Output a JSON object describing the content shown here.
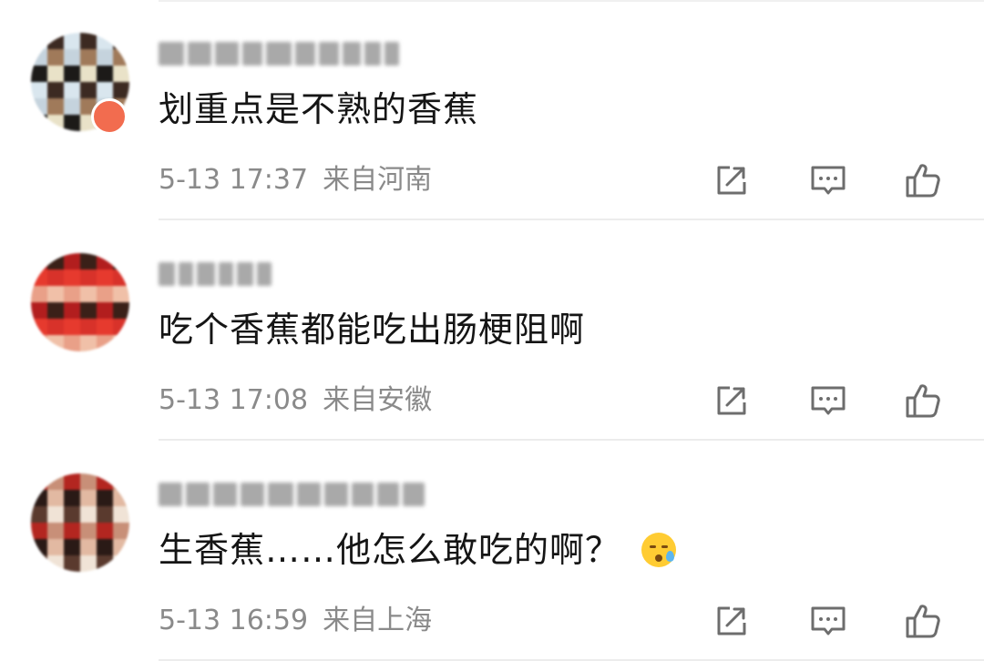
{
  "comments": [
    {
      "text": "划重点是不熟的香蕉",
      "date": "5-13 17:37",
      "location": "来自河南",
      "has_emoji": false,
      "avatar_colors": [
        "#d9e6ee",
        "#e9e2c8",
        "#c5d3dd",
        "#3c2a22",
        "#1c1a18",
        "#a07a5a"
      ],
      "username_blocks": [
        28,
        26,
        26,
        22,
        28,
        22,
        22,
        20,
        18,
        16
      ]
    },
    {
      "text": "吃个香蕉都能吃出肠梗阻啊",
      "date": "5-13 17:08",
      "location": "来自安徽",
      "has_emoji": false,
      "avatar_colors": [
        "#d8322a",
        "#b21e1e",
        "#f0c0a8",
        "#e63a2e",
        "#3a2018",
        "#e9a088"
      ],
      "username_blocks": [
        18,
        16,
        20,
        16,
        18,
        16
      ]
    },
    {
      "text": "生香蕉……他怎么敢吃的啊？",
      "date": "5-13 16:59",
      "location": "来自上海",
      "has_emoji": true,
      "emoji": "cold-sweat-face",
      "avatar_colors": [
        "#5a3a2e",
        "#e2b9a2",
        "#b32620",
        "#f0e3d6",
        "#2a1a16",
        "#c88f78"
      ],
      "username_blocks": [
        26,
        26,
        26,
        26,
        28,
        26,
        26,
        24,
        24,
        24
      ]
    }
  ],
  "icons": {
    "repost": "repost-icon",
    "comment": "comment-icon",
    "like": "like-icon"
  },
  "colors": {
    "meta_text": "#8a8a8a",
    "icon_stroke": "#6d6d6d",
    "divider": "#ececec"
  }
}
